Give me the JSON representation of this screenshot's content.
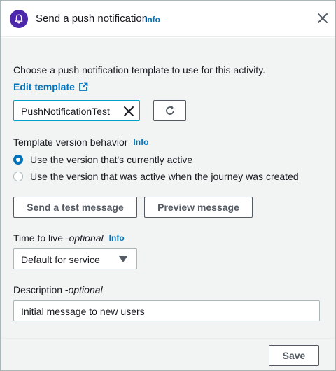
{
  "header": {
    "title": "Send a push notification",
    "info": "Info",
    "icon": "bell-icon",
    "icon_bg_color": "#4d27aa"
  },
  "template": {
    "prompt": "Choose a push notification template to use for this activity.",
    "edit_link": "Edit template",
    "selected_value": "PushNotificationTest"
  },
  "version": {
    "label": "Template version behavior",
    "info": "Info",
    "options": [
      {
        "label": "Use the version that's currently active",
        "selected": true
      },
      {
        "label": "Use the version that was active when the journey was created",
        "selected": false
      }
    ]
  },
  "actions": {
    "send_test": "Send a test message",
    "preview": "Preview message"
  },
  "ttl": {
    "label": "Time to live - ",
    "optional": "optional",
    "info": "Info",
    "selected": "Default for service"
  },
  "description": {
    "label": "Description - ",
    "optional": "optional",
    "value": "Initial message to new users"
  },
  "footer": {
    "save": "Save"
  },
  "colors": {
    "accent": "#0073bb",
    "input_focus": "#00a1c9",
    "body_bg": "#f2f3f3"
  }
}
